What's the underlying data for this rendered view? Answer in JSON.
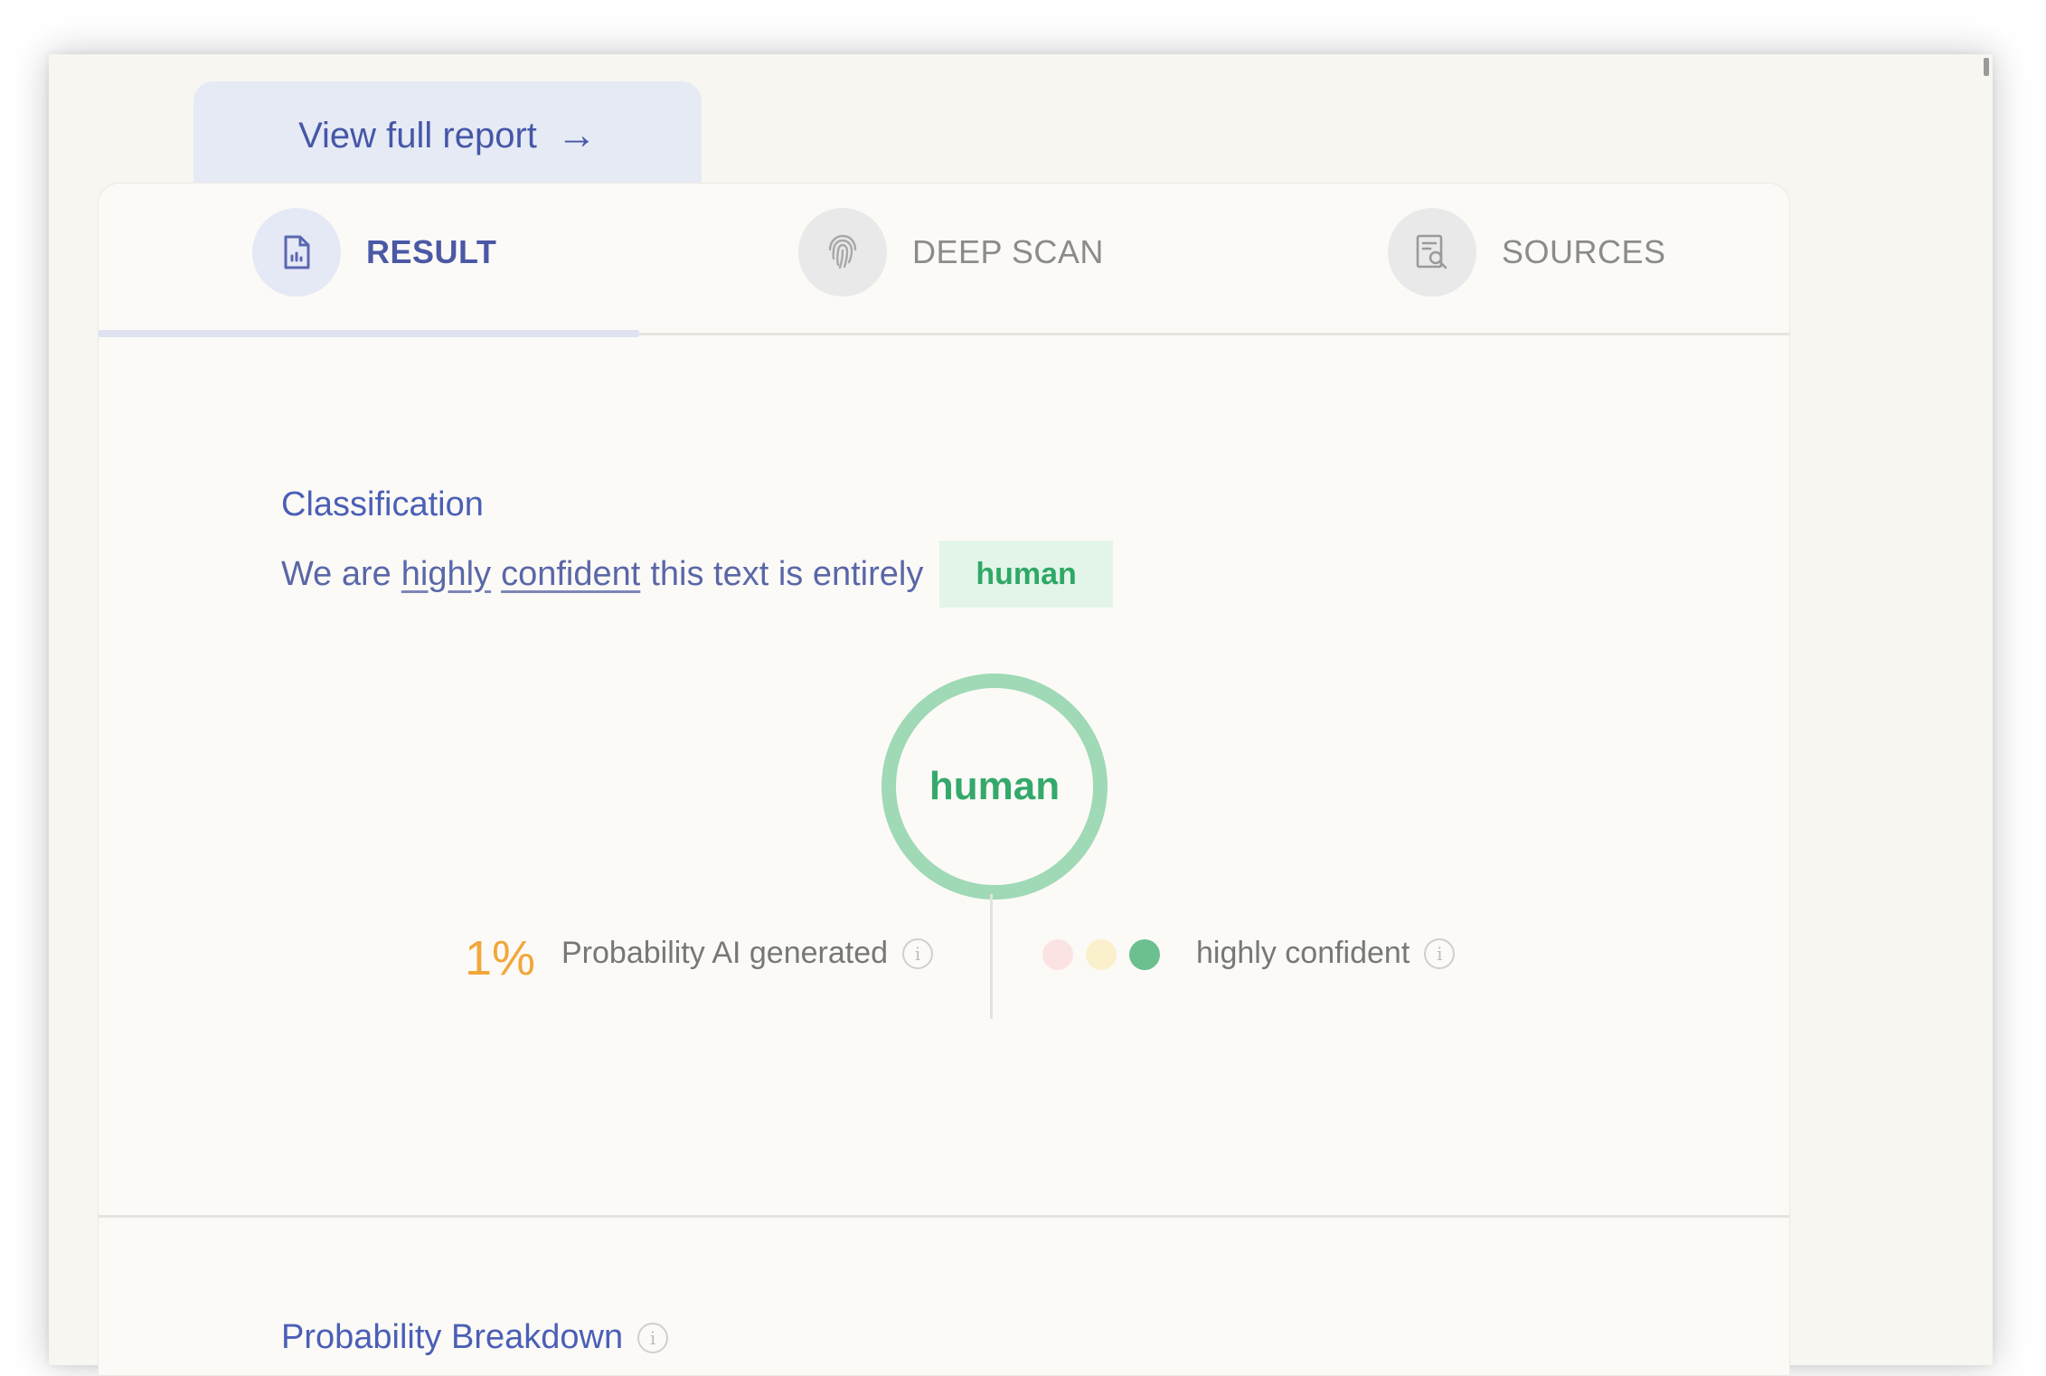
{
  "report_link": {
    "label": "View full report",
    "arrow": "→"
  },
  "tabs": [
    {
      "label": "RESULT",
      "icon": "document-icon",
      "active": true
    },
    {
      "label": "DEEP SCAN",
      "icon": "fingerprint-icon",
      "active": false
    },
    {
      "label": "SOURCES",
      "icon": "search-document-icon",
      "active": false
    }
  ],
  "classification": {
    "title": "Classification",
    "sentence_start": "We are",
    "highly": "highly",
    "confident": "confident",
    "sentence_end": "this text is entirely",
    "badge": "human"
  },
  "result_ring": {
    "label": "human",
    "color": "#9fd9b6"
  },
  "probability": {
    "value": "1%",
    "label": "Probability AI generated"
  },
  "confidence": {
    "label": "highly confident",
    "dots": [
      "#fbe3e3",
      "#fbf0cc",
      "#6cc08f"
    ]
  },
  "breakdown": {
    "title": "Probability Breakdown"
  },
  "colors": {
    "accent": "#4a58a6",
    "human_green": "#34a96b",
    "probability_orange": "#f1a73a"
  }
}
